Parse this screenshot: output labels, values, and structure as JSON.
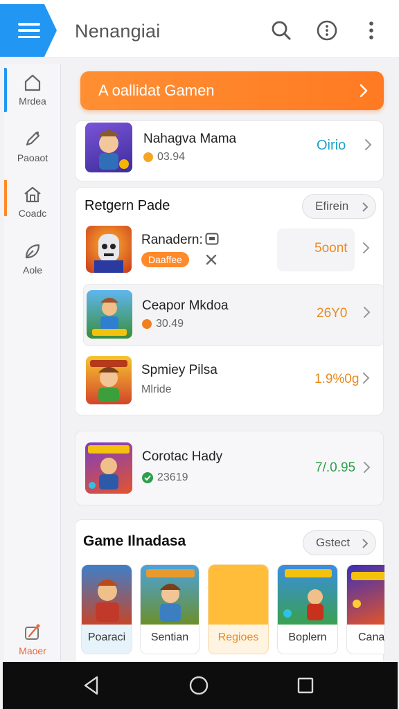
{
  "header": {
    "title": "Nenangiai"
  },
  "sidebar": {
    "items": [
      {
        "label": "Mrdea"
      },
      {
        "label": "Paoaot"
      },
      {
        "label": "Coadc"
      },
      {
        "label": "Aole"
      },
      {
        "label": "Maoer"
      }
    ]
  },
  "banner": {
    "label": "A oallidat Gamen"
  },
  "featured": {
    "title": "Nahagva Mama",
    "sub": "03.94",
    "value": "Oirio"
  },
  "section1": {
    "title": "Retgern Pade",
    "action": "Efirein",
    "rows": [
      {
        "title": "Ranadern:",
        "badge": "Daaffee",
        "value": "5oont"
      },
      {
        "title": "Ceapor Mkdoa",
        "sub": "30.49",
        "value": "26Y0"
      },
      {
        "title": "Spmiey Pilsa",
        "sub": "Mlride",
        "value": "1.9%0g"
      }
    ]
  },
  "single": {
    "title": "Corotac Hady",
    "sub": "23619",
    "value": "7/.0.95"
  },
  "section2": {
    "title": "Game Ilnadasa",
    "action": "Gstect",
    "tiles": [
      {
        "label": "Poaraci"
      },
      {
        "label": "Sentian"
      },
      {
        "label": "Regioes"
      },
      {
        "label": "Boplern"
      },
      {
        "label": "Canar"
      }
    ]
  },
  "colors": {
    "accent": "#2196f3",
    "orange": "#ff8a2a",
    "green": "#2e9e4a",
    "teal": "#1aa3c8"
  }
}
